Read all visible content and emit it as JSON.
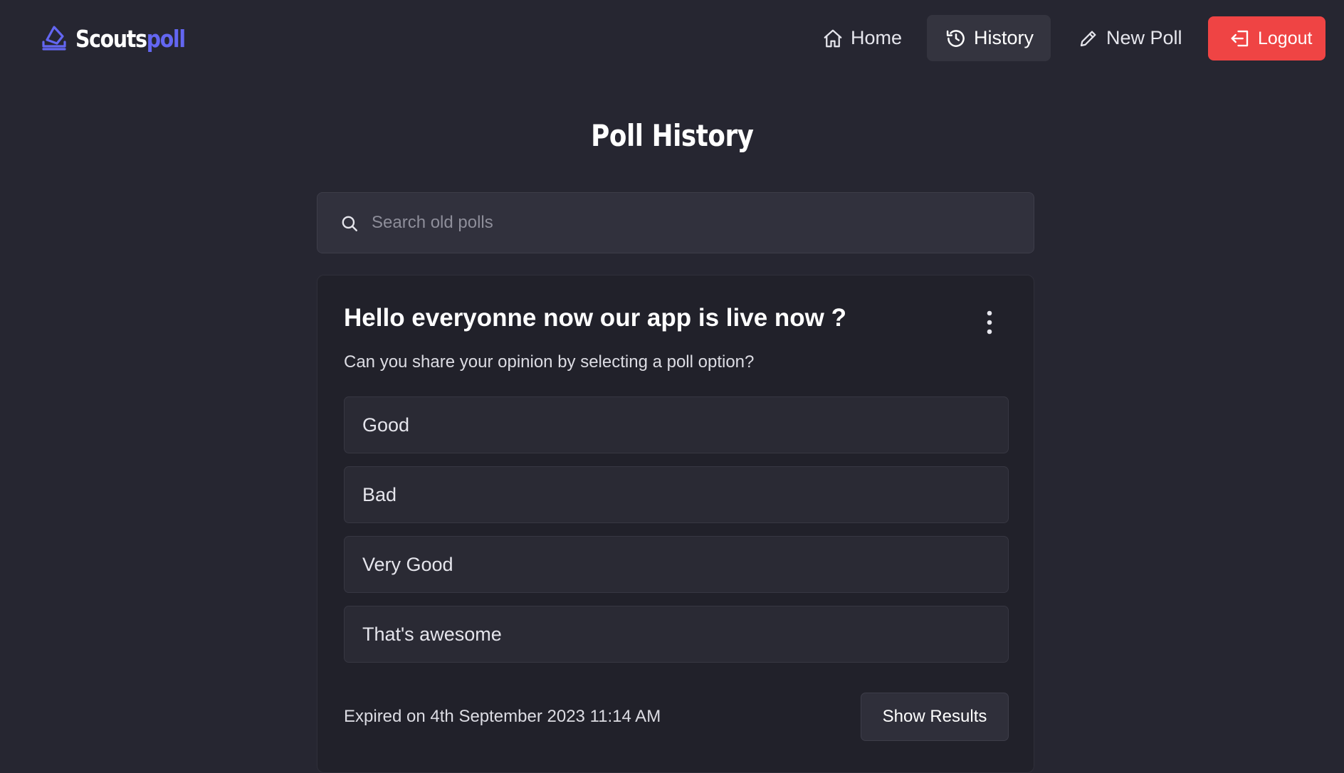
{
  "brand": {
    "part1": "Scouts",
    "part2": "poll",
    "icon": "ballot-box-icon",
    "accent": "#6366f1"
  },
  "nav": {
    "home": {
      "label": "Home",
      "icon": "home-icon"
    },
    "history": {
      "label": "History",
      "icon": "history-icon",
      "active": true
    },
    "new_poll": {
      "label": "New Poll",
      "icon": "pencil-icon"
    },
    "logout": {
      "label": "Logout",
      "icon": "logout-icon",
      "color": "#ef4444"
    }
  },
  "page": {
    "title": "Poll History"
  },
  "search": {
    "placeholder": "Search old polls",
    "value": ""
  },
  "poll": {
    "title": "Hello everyonne now our app is live now ?",
    "description": "Can you share your opinion by selecting a poll option?",
    "options": [
      "Good",
      "Bad",
      "Very Good",
      "That's awesome"
    ],
    "expired_text": "Expired on 4th September 2023 11:14 AM",
    "show_results_label": "Show Results"
  }
}
